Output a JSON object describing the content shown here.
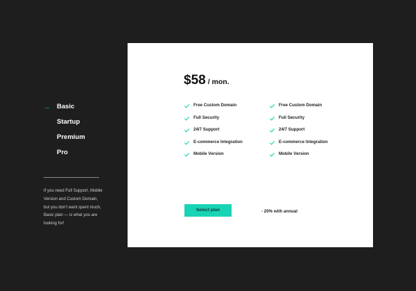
{
  "nav": {
    "items": [
      {
        "label": "Basic",
        "active": true
      },
      {
        "label": "Startup",
        "active": false
      },
      {
        "label": "Premium",
        "active": false
      },
      {
        "label": "Pro",
        "active": false
      }
    ],
    "arrow_icon": "arrow-right-icon"
  },
  "description": "If you need Full Support, Mobile Version and Custom Domain, but you don't want spent much, Basic plan — is what you are looking for!",
  "card": {
    "price": "$58",
    "period": "/ mon.",
    "features_left": [
      "Free Custom Domain",
      "Full Security",
      "24/7 Support",
      "E-commerce Integration",
      "Mobile Version"
    ],
    "features_right": [
      "Free Custom Domain",
      "Full Security",
      "24/7 Support",
      "E-commerce Integration",
      "Mobile Version"
    ],
    "check_icon": "checkmark-icon",
    "select_label": "Select plan",
    "annual_text": "- 20% with annual"
  },
  "colors": {
    "background": "#1e1e1e",
    "accent": "#19d3b5",
    "card": "#ffffff"
  }
}
